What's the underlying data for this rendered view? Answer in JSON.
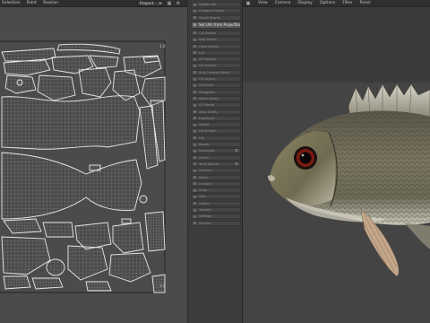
{
  "uv_editor": {
    "menu": [
      "Selection",
      "Point",
      "Session"
    ],
    "projection_dropdown": "Project",
    "corner_labels": {
      "top_right": "1.0",
      "bottom_right": "1.0"
    }
  },
  "tools": {
    "items": [
      {
        "label": "Update Sel",
        "state": "normal"
      },
      {
        "label": "Compute Frame",
        "state": "normal"
      },
      {
        "label": "Select Seams",
        "state": "normal"
      },
      {
        "label": "Set UVs from Projection",
        "state": "active"
      },
      {
        "label": "Cut Seams",
        "state": "normal"
      },
      {
        "label": "Sew Seams",
        "state": "normal"
      },
      {
        "label": "Clear Seams",
        "state": "normal"
      },
      {
        "label": "Cut",
        "state": "normal"
      },
      {
        "label": "UV Repack",
        "state": "normal"
      },
      {
        "label": "UV Unwrap",
        "state": "normal"
      },
      {
        "label": "Auto Unwrap Shells",
        "state": "normal"
      },
      {
        "label": "UV Layout",
        "state": "normal"
      },
      {
        "label": "UV Relax",
        "state": "normal"
      },
      {
        "label": "Straighten",
        "state": "normal"
      },
      {
        "label": "Match Shells",
        "state": "normal"
      },
      {
        "label": "UV Merge",
        "state": "normal"
      },
      {
        "label": "Align Shells",
        "state": "normal"
      },
      {
        "label": "Distribute",
        "state": "normal"
      },
      {
        "label": "Unfold",
        "state": "normal"
      },
      {
        "label": "UV Smooth",
        "state": "normal"
      },
      {
        "label": "Flip",
        "state": "normal"
      },
      {
        "label": "Rotate",
        "state": "normal"
      },
      {
        "label": "Normalize",
        "state": "normal"
      },
      {
        "label": "Orient",
        "state": "normal"
      },
      {
        "label": "Texel Density",
        "state": "normal"
      },
      {
        "label": "Checker",
        "state": "normal"
      },
      {
        "label": "Stack",
        "state": "normal"
      },
      {
        "label": "Unstack",
        "state": "normal"
      },
      {
        "label": "Snap",
        "state": "normal"
      },
      {
        "label": "Grid",
        "state": "normal"
      },
      {
        "label": "Gather",
        "state": "normal"
      },
      {
        "label": "Transfer",
        "state": "normal"
      },
      {
        "label": "Settings",
        "state": "normal"
      },
      {
        "label": "Preview",
        "state": "normal"
      }
    ]
  },
  "viewport": {
    "menu": [
      "View",
      "Camera",
      "Display",
      "Options",
      "Filter",
      "Panel"
    ]
  }
}
